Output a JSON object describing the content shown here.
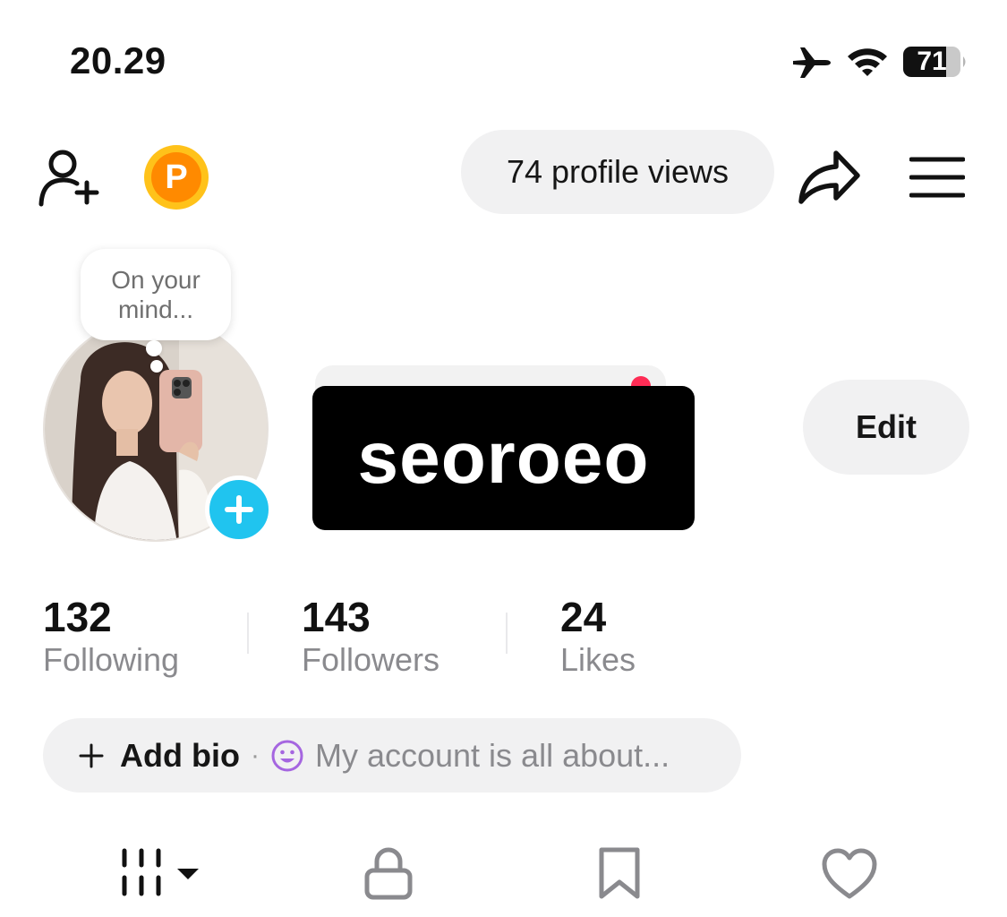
{
  "status_bar": {
    "time": "20.29",
    "battery_level": "71"
  },
  "header": {
    "profile_views": "74 profile views"
  },
  "profile": {
    "bubble_text": "On your mind...",
    "username": "seoroeo",
    "edit_label": "Edit"
  },
  "stats": [
    {
      "value": "132",
      "label": "Following"
    },
    {
      "value": "143",
      "label": "Followers"
    },
    {
      "value": "24",
      "label": "Likes"
    }
  ],
  "bio": {
    "add_label": "Add bio",
    "separator": "·",
    "placeholder": "My account is all about..."
  },
  "tabs": [
    {
      "icon": "videos-grid-icon",
      "active": true
    },
    {
      "icon": "lock-icon",
      "active": false
    },
    {
      "icon": "bookmark-icon",
      "active": false
    },
    {
      "icon": "heart-icon",
      "active": false
    }
  ],
  "colors": {
    "accent_cyan": "#20C4EF",
    "notification_red": "#FE2C55",
    "coin_gold": "#FFC21A",
    "coin_orange": "#FF8A00",
    "emoji_purple": "#A566E0",
    "pill_gray": "#F1F1F2"
  }
}
